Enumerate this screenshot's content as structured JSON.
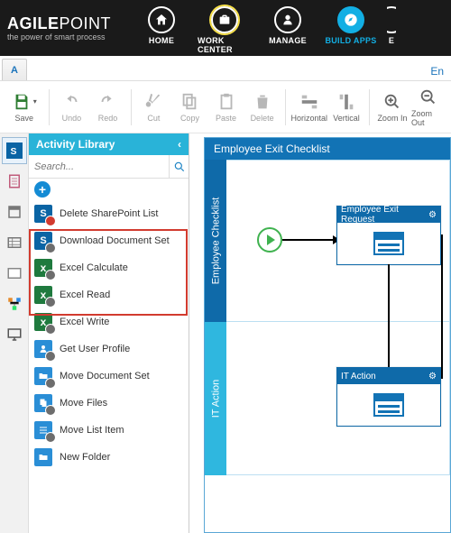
{
  "brand": {
    "word1": "AGILE",
    "word2": "POINT",
    "tag": "the power of smart process"
  },
  "topnav": {
    "home": "HOME",
    "workcenter": "WORK CENTER",
    "manage": "MANAGE",
    "buildapps": "BUILD APPS",
    "cut": "E"
  },
  "docstrip": {
    "tab": "A",
    "right": "En"
  },
  "toolbar": {
    "save": "Save",
    "undo": "Undo",
    "redo": "Redo",
    "cut": "Cut",
    "copy": "Copy",
    "paste": "Paste",
    "delete": "Delete",
    "horizontal": "Horizontal",
    "vertical": "Vertical",
    "zoomin": "Zoom In",
    "zoomout": "Zoom Out"
  },
  "library": {
    "title": "Activity Library",
    "searchPlaceholder": "Search...",
    "items": {
      "deleteSpList": "Delete SharePoint List",
      "downloadDocSet": "Download Document Set",
      "excelCalc": "Excel Calculate",
      "excelRead": "Excel Read",
      "excelWrite": "Excel Write",
      "getUserProfile": "Get User Profile",
      "moveDocSet": "Move Document Set",
      "moveFiles": "Move Files",
      "moveListItem": "Move List Item",
      "newFolder": "New Folder"
    }
  },
  "canvas": {
    "poolTitle": "Employee Exit Checklist",
    "lane1": "Employee Checklist",
    "lane2": "IT Action",
    "node1": "Employee Exit Request",
    "node2": "IT Action"
  }
}
